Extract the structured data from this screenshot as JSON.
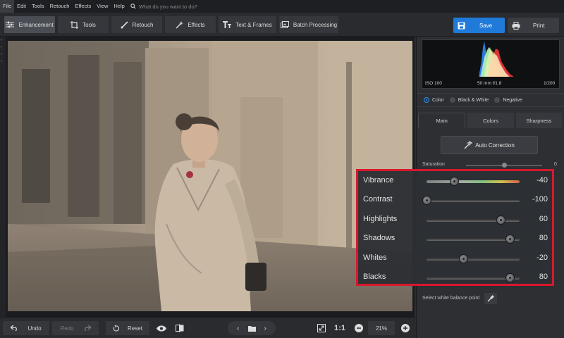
{
  "menu": {
    "items": [
      "File",
      "Edit",
      "Tools",
      "Retouch",
      "Effects",
      "View",
      "Help"
    ],
    "search_placeholder": "What do you want to do?"
  },
  "toolbar": {
    "tabs": [
      "Enhancement",
      "Tools",
      "Retouch",
      "Effects",
      "Text & Frames",
      "Batch Processing"
    ],
    "save_label": "Save",
    "print_label": "Print"
  },
  "histogram": {
    "iso": "ISO 100",
    "lens": "50 mm f/1.8",
    "shutter": "1/200"
  },
  "color_mode": {
    "options": [
      "Color",
      "Black & White",
      "Negative"
    ],
    "selected": "Color"
  },
  "panel_tabs": [
    "Main",
    "Colors",
    "Sharpness"
  ],
  "auto_correction_label": "Auto Correction",
  "saturation": {
    "label": "Saturation",
    "value": "0",
    "fraction": 0.5
  },
  "sliders": [
    {
      "label": "Vibrance",
      "value": "-40",
      "fraction": 0.3
    },
    {
      "label": "Contrast",
      "value": "-100",
      "fraction": 0.0
    },
    {
      "label": "Highlights",
      "value": "60",
      "fraction": 0.8
    },
    {
      "label": "Shadows",
      "value": "80",
      "fraction": 0.9
    },
    {
      "label": "Whites",
      "value": "-20",
      "fraction": 0.4
    },
    {
      "label": "Blacks",
      "value": "80",
      "fraction": 0.9
    }
  ],
  "white_balance_label": "Select white balance point",
  "bottom": {
    "undo_label": "Undo",
    "redo_label": "Redo",
    "reset_label": "Reset",
    "zoom_ratio_label": "1:1",
    "zoom_percent": "21%"
  },
  "colors": {
    "accent": "#1f7ad9",
    "highlight_border": "#d8182d"
  }
}
